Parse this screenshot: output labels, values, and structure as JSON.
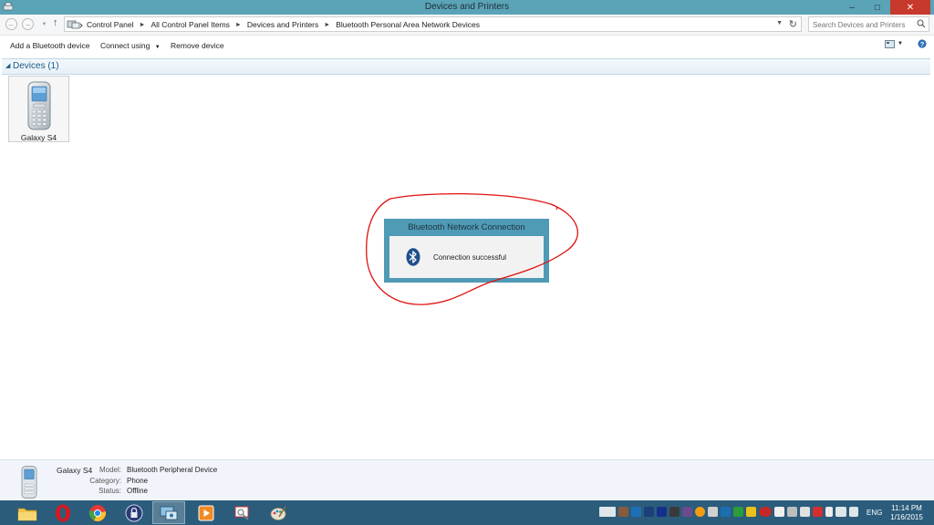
{
  "window": {
    "title": "Devices and Printers",
    "controls": [
      "minimize",
      "maximize",
      "close"
    ]
  },
  "address": {
    "breadcrumbs": [
      "Control Panel",
      "All Control Panel Items",
      "Devices and Printers",
      "Bluetooth Personal Area Network Devices"
    ],
    "search_placeholder": "Search Devices and Printers"
  },
  "toolbar": {
    "add_bluetooth": "Add a Bluetooth device",
    "connect_using": "Connect using",
    "remove_device": "Remove device"
  },
  "group": {
    "label": "Devices (1)"
  },
  "devices": [
    {
      "name": "Galaxy S4"
    }
  ],
  "toast": {
    "title": "Bluetooth Network Connection",
    "message": "Connection successful"
  },
  "details": {
    "name": "Galaxy S4",
    "rows": [
      {
        "key": "Model:",
        "value": "Bluetooth Peripheral Device"
      },
      {
        "key": "Category:",
        "value": "Phone"
      },
      {
        "key": "Status:",
        "value": "Offline"
      }
    ]
  },
  "taskbar": {
    "apps": [
      "file-explorer",
      "opera",
      "chrome",
      "keepass",
      "control-panel",
      "media-player",
      "snipping-tool",
      "paint"
    ],
    "language": "ENG",
    "time": "11:14 PM",
    "date": "1/16/2015"
  },
  "colors": {
    "titlebar": "#5ba3b7",
    "toast": "#4f9ab5",
    "taskbar": "#2b5c7b",
    "annotation": "#e01010"
  }
}
